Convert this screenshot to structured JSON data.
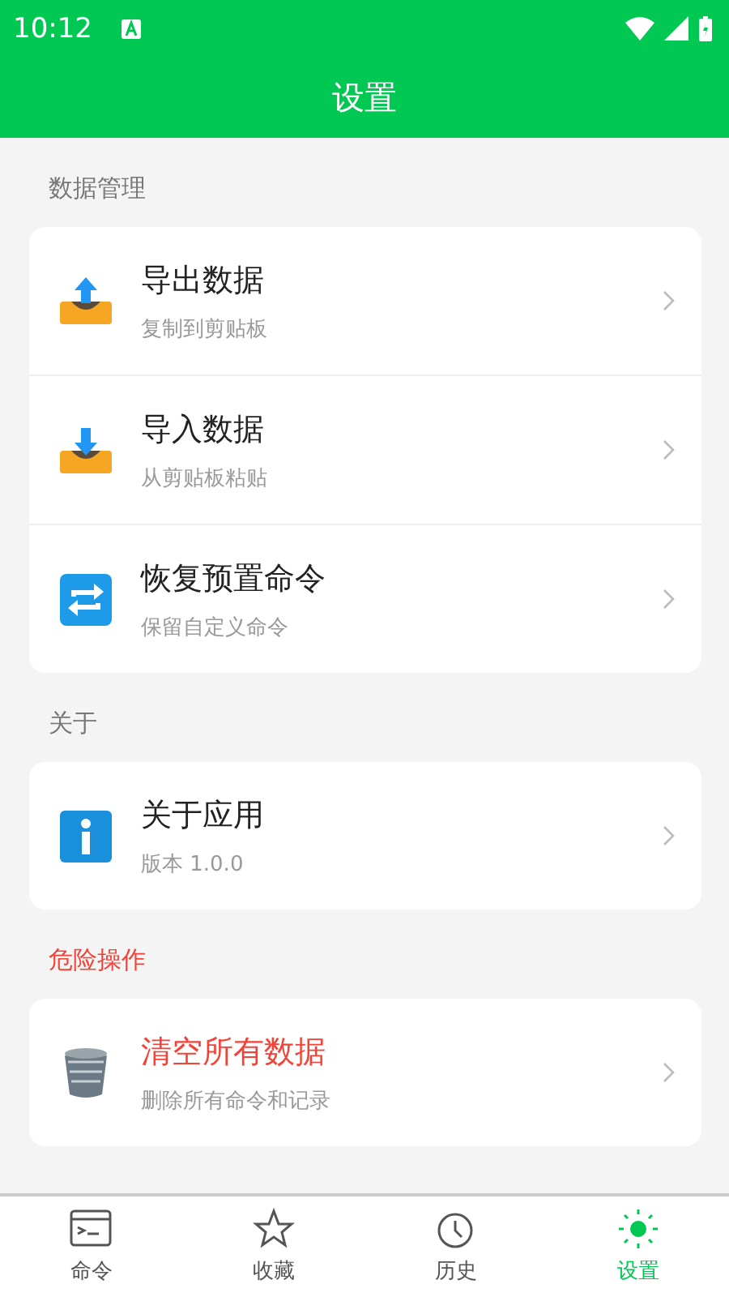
{
  "status_bar": {
    "time": "10:12"
  },
  "header": {
    "title": "设置"
  },
  "sections": [
    {
      "title": "数据管理",
      "kind": "normal",
      "items": [
        {
          "kind": "export",
          "title": "导出数据",
          "subtitle": "复制到剪贴板"
        },
        {
          "kind": "import",
          "title": "导入数据",
          "subtitle": "从剪贴板粘贴"
        },
        {
          "kind": "restore",
          "title": "恢复预置命令",
          "subtitle": "保留自定义命令"
        }
      ]
    },
    {
      "title": "关于",
      "kind": "normal",
      "items": [
        {
          "kind": "info",
          "title": "关于应用",
          "subtitle": "版本 1.0.0"
        }
      ]
    },
    {
      "title": "危险操作",
      "kind": "danger",
      "items": [
        {
          "kind": "trash",
          "title": "清空所有数据",
          "subtitle": "删除所有命令和记录"
        }
      ]
    }
  ],
  "bottom_nav": [
    {
      "kind": "terminal",
      "label": "命令",
      "selected": false
    },
    {
      "kind": "star",
      "label": "收藏",
      "selected": false
    },
    {
      "kind": "clock",
      "label": "历史",
      "selected": false
    },
    {
      "kind": "sun",
      "label": "设置",
      "selected": true
    }
  ]
}
